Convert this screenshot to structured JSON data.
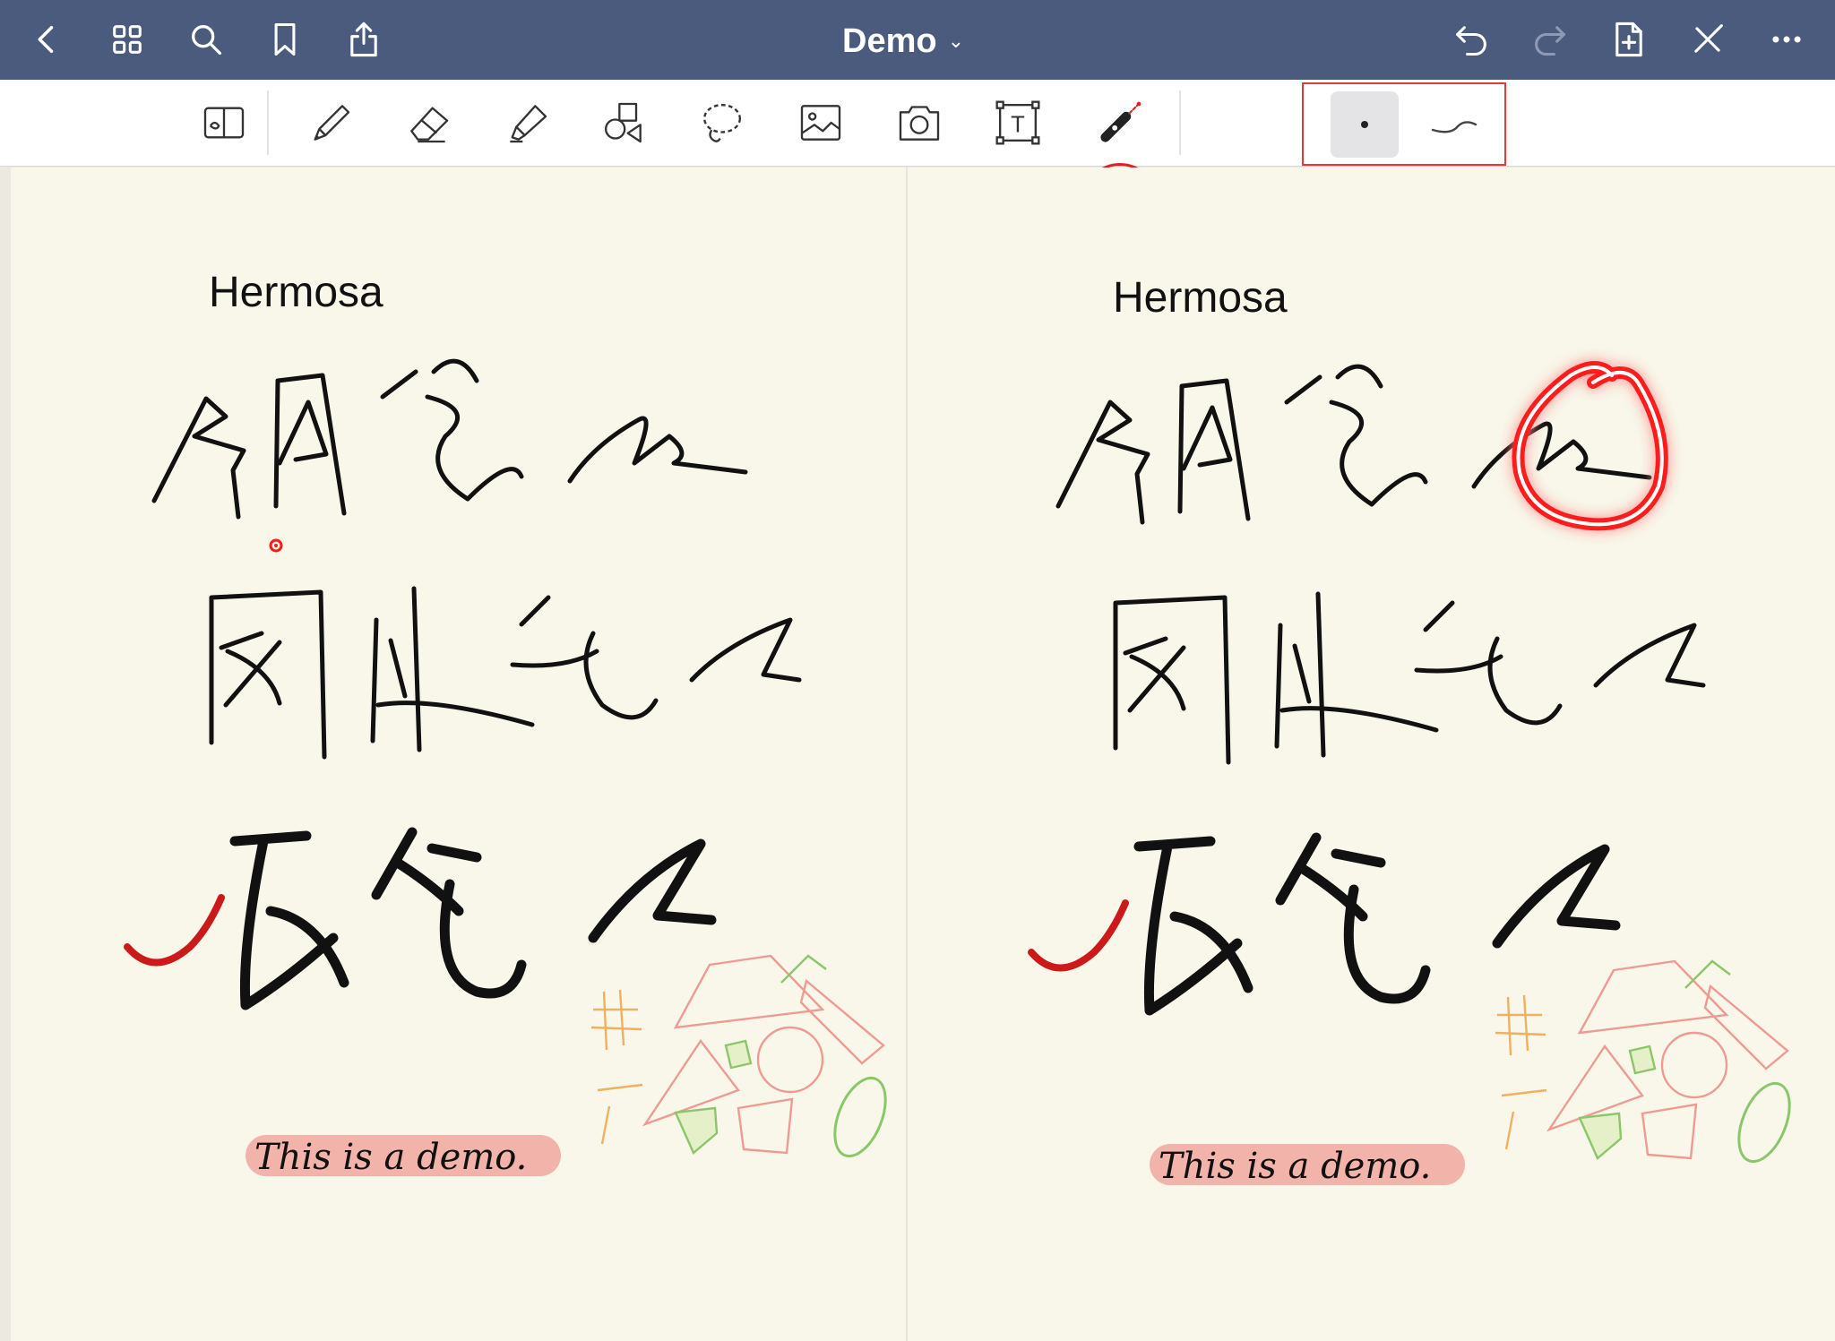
{
  "window": {
    "title": "Demo",
    "title_chevron": "⌄"
  },
  "topbar": {
    "left_icons": [
      "back-icon",
      "grid-icon",
      "search-icon",
      "bookmark-icon",
      "share-icon"
    ],
    "right_icons": [
      "undo-icon",
      "redo-icon",
      "add-page-icon",
      "pen-off-icon",
      "more-icon"
    ]
  },
  "toolbar": {
    "tools": [
      "read-mode-icon",
      "pen-icon",
      "eraser-icon",
      "highlighter-icon",
      "shapes-icon",
      "lasso-icon",
      "image-icon",
      "camera-icon",
      "text-box-icon",
      "laser-pointer-icon"
    ],
    "selected_tool": "laser-pointer-icon",
    "text_tool_glyph": "T",
    "laser_options": [
      "dot-option",
      "trail-option"
    ],
    "selected_laser_option": "dot-option",
    "accent": "#e02020"
  },
  "pages": [
    {
      "header": "Hermosa",
      "footer_note": "This is a demo.",
      "highlight_color": "#f2b3ab"
    },
    {
      "header": "Hermosa",
      "footer_note": "This is a demo.",
      "highlight_color": "#f2b3ab"
    }
  ],
  "colors": {
    "topbar": "#4b5b7d",
    "paper": "#f8f7ea",
    "laser": "#ff1a1a",
    "check": "#d01818"
  }
}
